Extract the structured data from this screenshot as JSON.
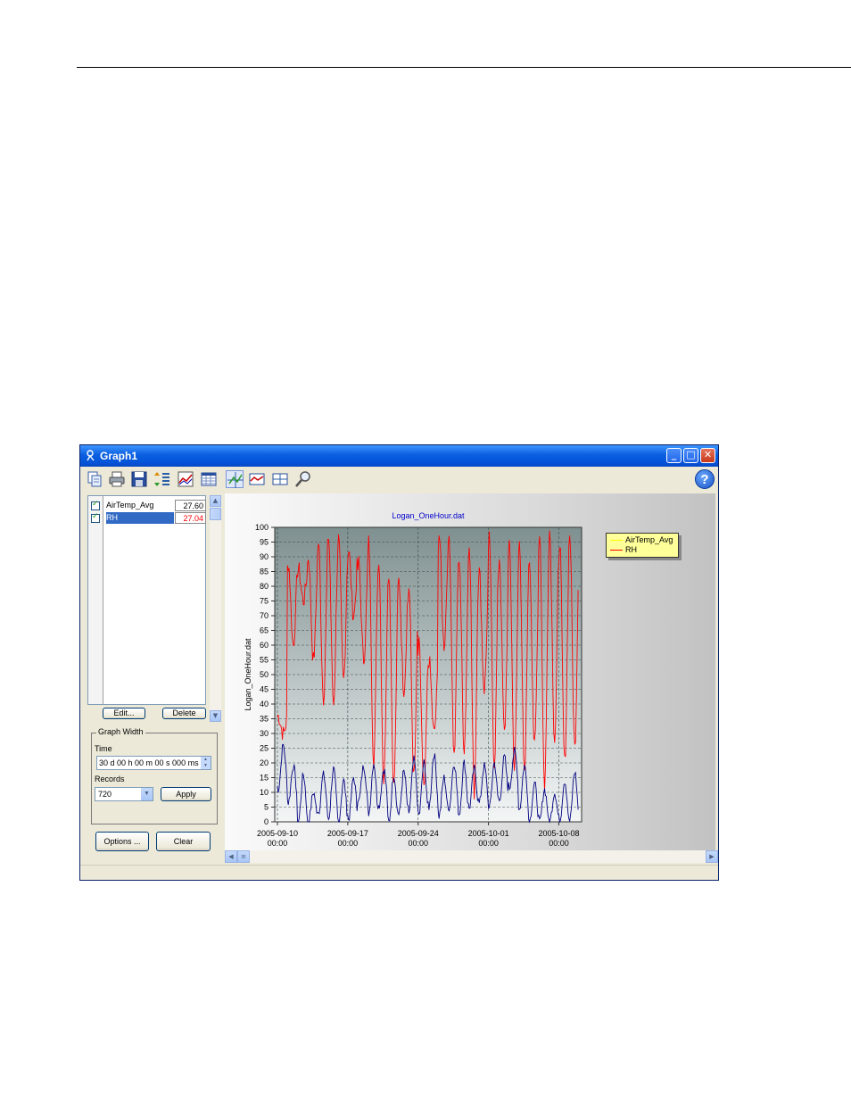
{
  "window": {
    "title": "Graph1"
  },
  "window_controls": {
    "minimize": "_",
    "maximize": "□",
    "close": "✕"
  },
  "toolbar": {
    "icons": [
      "copy-icon",
      "print-icon",
      "save-icon",
      "sort-list-icon",
      "graph-setup-icon",
      "table-icon",
      "scale-icon",
      "trend-icon",
      "cursor-icon",
      "zoom-icon"
    ],
    "help_label": "?"
  },
  "traces": {
    "items": [
      {
        "label": "AirTemp_Avg",
        "value": "27.60",
        "checked": true,
        "value_color": "#000000"
      },
      {
        "label": "RH",
        "value": "27.04",
        "checked": true,
        "value_color": "#ff0000",
        "selected": true
      }
    ],
    "edit_label": "Edit...",
    "delete_label": "Delete"
  },
  "graph_width": {
    "title": "Graph Width",
    "time_label": "Time",
    "time_value": "30 d 00 h 00 m 00 s 000 ms",
    "records_label": "Records",
    "records_value": "720",
    "apply_label": "Apply"
  },
  "footer_buttons": {
    "options_label": "Options ...",
    "clear_label": "Clear"
  },
  "chart_data": {
    "type": "line",
    "title": "Logan_OneHour.dat",
    "ylabel": "Logan_OneHour.dat",
    "xlabel": "",
    "ylim": [
      0,
      100
    ],
    "y_ticks": [
      "0",
      "5",
      "10",
      "15",
      "20",
      "25",
      "30",
      "35",
      "40",
      "45",
      "50",
      "55",
      "60",
      "65",
      "70",
      "75",
      "80",
      "85",
      "90",
      "95",
      "100"
    ],
    "x_ticks": [
      {
        "date": "2005-09-10",
        "time": "00:00"
      },
      {
        "date": "2005-09-17",
        "time": "00:00"
      },
      {
        "date": "2005-09-24",
        "time": "00:00"
      },
      {
        "date": "2005-10-01",
        "time": "00:00"
      },
      {
        "date": "2005-10-08",
        "time": "00:00"
      }
    ],
    "grid": true,
    "legend_position": "right",
    "series": [
      {
        "name": "AirTemp_Avg",
        "legend_color": "#ffff00",
        "color": "#000080",
        "note_values": "daily cycle, ranges about 0 to 24",
        "daily_max": [
          26,
          19,
          16,
          10,
          16,
          18,
          14,
          15,
          19,
          20,
          18,
          16,
          17,
          21,
          20,
          23,
          15,
          20,
          20,
          18,
          19,
          20,
          22,
          24,
          19,
          13,
          11,
          10,
          14,
          17,
          20,
          16
        ]
      },
      {
        "name": "RH",
        "legend_color": "#ff0000",
        "color": "#ff0000",
        "daily_min": [
          30,
          60,
          75,
          55,
          42,
          40,
          48,
          70,
          55,
          21,
          14,
          12,
          45,
          15,
          10,
          30,
          60,
          22,
          25,
          10,
          45,
          20,
          30,
          18,
          15,
          25,
          12,
          28,
          20,
          25,
          20,
          60
        ],
        "daily_max": [
          36,
          88,
          86,
          90,
          95,
          97,
          96,
          92,
          88,
          95,
          90,
          85,
          82,
          80,
          60,
          55,
          98,
          97,
          90,
          96,
          85,
          96,
          90,
          95,
          96,
          89,
          99,
          99,
          96,
          98,
          96,
          100
        ]
      }
    ]
  }
}
